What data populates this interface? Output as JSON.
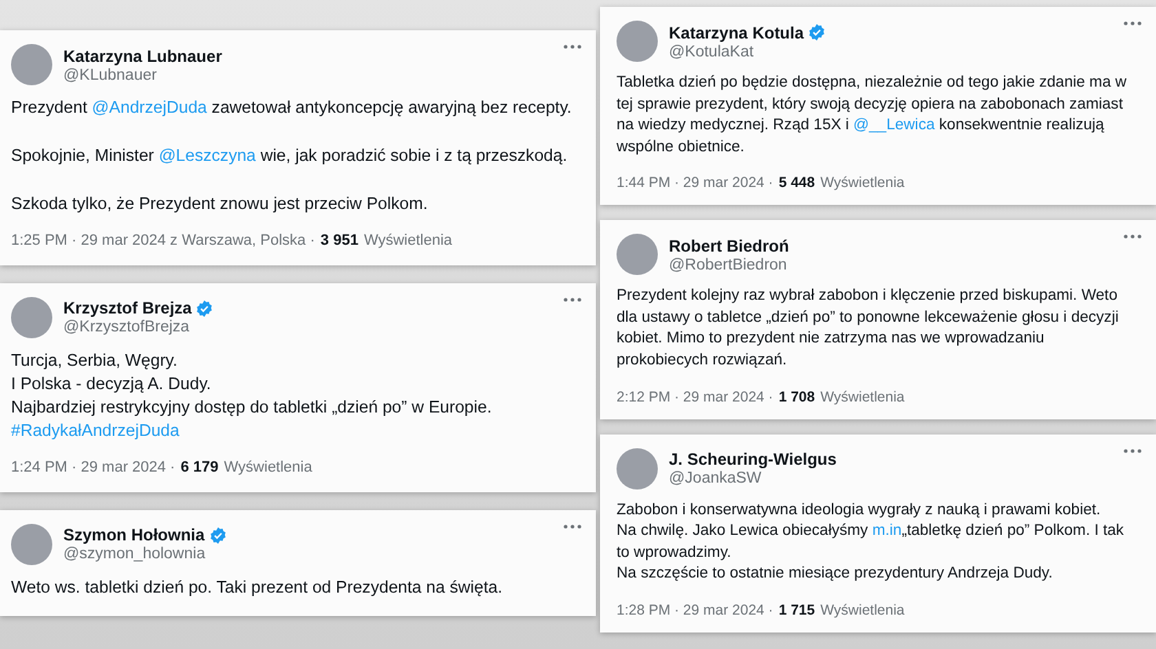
{
  "columns": [
    {
      "tweets": [
        {
          "name": "Katarzyna Lubnauer",
          "handle": "@KLubnauer",
          "verified": false,
          "paragraphs": [
            [
              [
                {
                  "kind": "text",
                  "text": "Prezydent "
                },
                {
                  "kind": "mention",
                  "text": "@AndrzejDuda"
                },
                {
                  "kind": "text",
                  "text": " zawetował antykoncepcję awaryjną bez recepty."
                }
              ]
            ],
            [
              [
                {
                  "kind": "text",
                  "text": "Spokojnie, Minister "
                },
                {
                  "kind": "mention",
                  "text": "@Leszczyna"
                },
                {
                  "kind": "text",
                  "text": " wie, jak poradzić sobie i z tą przeszkodą."
                }
              ]
            ],
            [
              [
                {
                  "kind": "text",
                  "text": "Szkoda tylko, że Prezydent znowu jest przeciw Polkom."
                }
              ]
            ]
          ],
          "timestamp": "1:25 PM · 29 mar 2024 z Warszawa, Polska ·",
          "views": "3 951",
          "views_label": "Wyświetlenia"
        },
        {
          "name": "Krzysztof Brejza",
          "handle": "@KrzysztofBrejza",
          "verified": true,
          "paragraphs": [
            [
              [
                {
                  "kind": "text",
                  "text": "Turcja, Serbia, Węgry."
                }
              ],
              [
                {
                  "kind": "text",
                  "text": "I Polska - decyzją A. Dudy."
                }
              ],
              [
                {
                  "kind": "text",
                  "text": "Najbardziej restrykcyjny dostęp do tabletki „dzień po” w Europie."
                }
              ],
              [
                {
                  "kind": "mention",
                  "text": "#RadykałAndrzejDuda"
                }
              ]
            ]
          ],
          "timestamp": "1:24 PM · 29 mar 2024 ·",
          "views": "6 179",
          "views_label": "Wyświetlenia"
        },
        {
          "name": "Szymon Hołownia",
          "handle": "@szymon_holownia",
          "verified": true,
          "paragraphs": [
            [
              [
                {
                  "kind": "text",
                  "text": "Weto ws. tabletki dzień po. Taki prezent od Prezydenta na święta."
                }
              ]
            ]
          ]
        }
      ]
    },
    {
      "tweets": [
        {
          "name": "Katarzyna Kotula",
          "handle": "@KotulaKat",
          "verified": true,
          "paragraphs": [
            [
              [
                {
                  "kind": "text",
                  "text": "Tabletka dzień po będzie dostępna, niezależnie od tego jakie zdanie ma w tej sprawie prezydent, który swoją decyzję opiera na zabobonach zamiast na wiedzy medycznej. Rząd 15X i "
                },
                {
                  "kind": "mention",
                  "text": "@__Lewica"
                },
                {
                  "kind": "text",
                  "text": " konsekwentnie realizują wspólne obietnice."
                }
              ]
            ]
          ],
          "timestamp": "1:44 PM · 29 mar 2024 ·",
          "views": "5 448",
          "views_label": "Wyświetlenia"
        },
        {
          "name": "Robert Biedroń",
          "handle": "@RobertBiedron",
          "verified": false,
          "paragraphs": [
            [
              [
                {
                  "kind": "text",
                  "text": "Prezydent kolejny raz wybrał zabobon i klęczenie przed biskupami. Weto dla ustawy o tabletce „dzień po” to ponowne lekceważenie głosu i decyzji kobiet. Mimo to prezydent nie zatrzyma nas we wprowadzaniu prokobiecych rozwiązań."
                }
              ]
            ]
          ],
          "timestamp": "2:12 PM · 29 mar 2024 ·",
          "views": "1 708",
          "views_label": "Wyświetlenia"
        },
        {
          "name": "J. Scheuring-Wielgus",
          "handle": "@JoankaSW",
          "verified": false,
          "paragraphs": [
            [
              [
                {
                  "kind": "text",
                  "text": "Zabobon i konserwatywna ideologia wygrały z nauką i prawami kobiet."
                }
              ],
              [
                {
                  "kind": "text",
                  "text": "Na chwilę. Jako Lewica obiecałyśmy "
                },
                {
                  "kind": "mention",
                  "text": "m.in"
                },
                {
                  "kind": "text",
                  "text": "„tabletkę dzień po” Polkom.  I tak to  wprowadzimy."
                }
              ],
              [
                {
                  "kind": "text",
                  "text": "Na szczęście to ostatnie miesiące prezydentury Andrzeja Dudy."
                }
              ]
            ]
          ],
          "timestamp": "1:28 PM · 29 mar 2024 ·",
          "views": "1 715",
          "views_label": "Wyświetlenia"
        }
      ]
    }
  ]
}
